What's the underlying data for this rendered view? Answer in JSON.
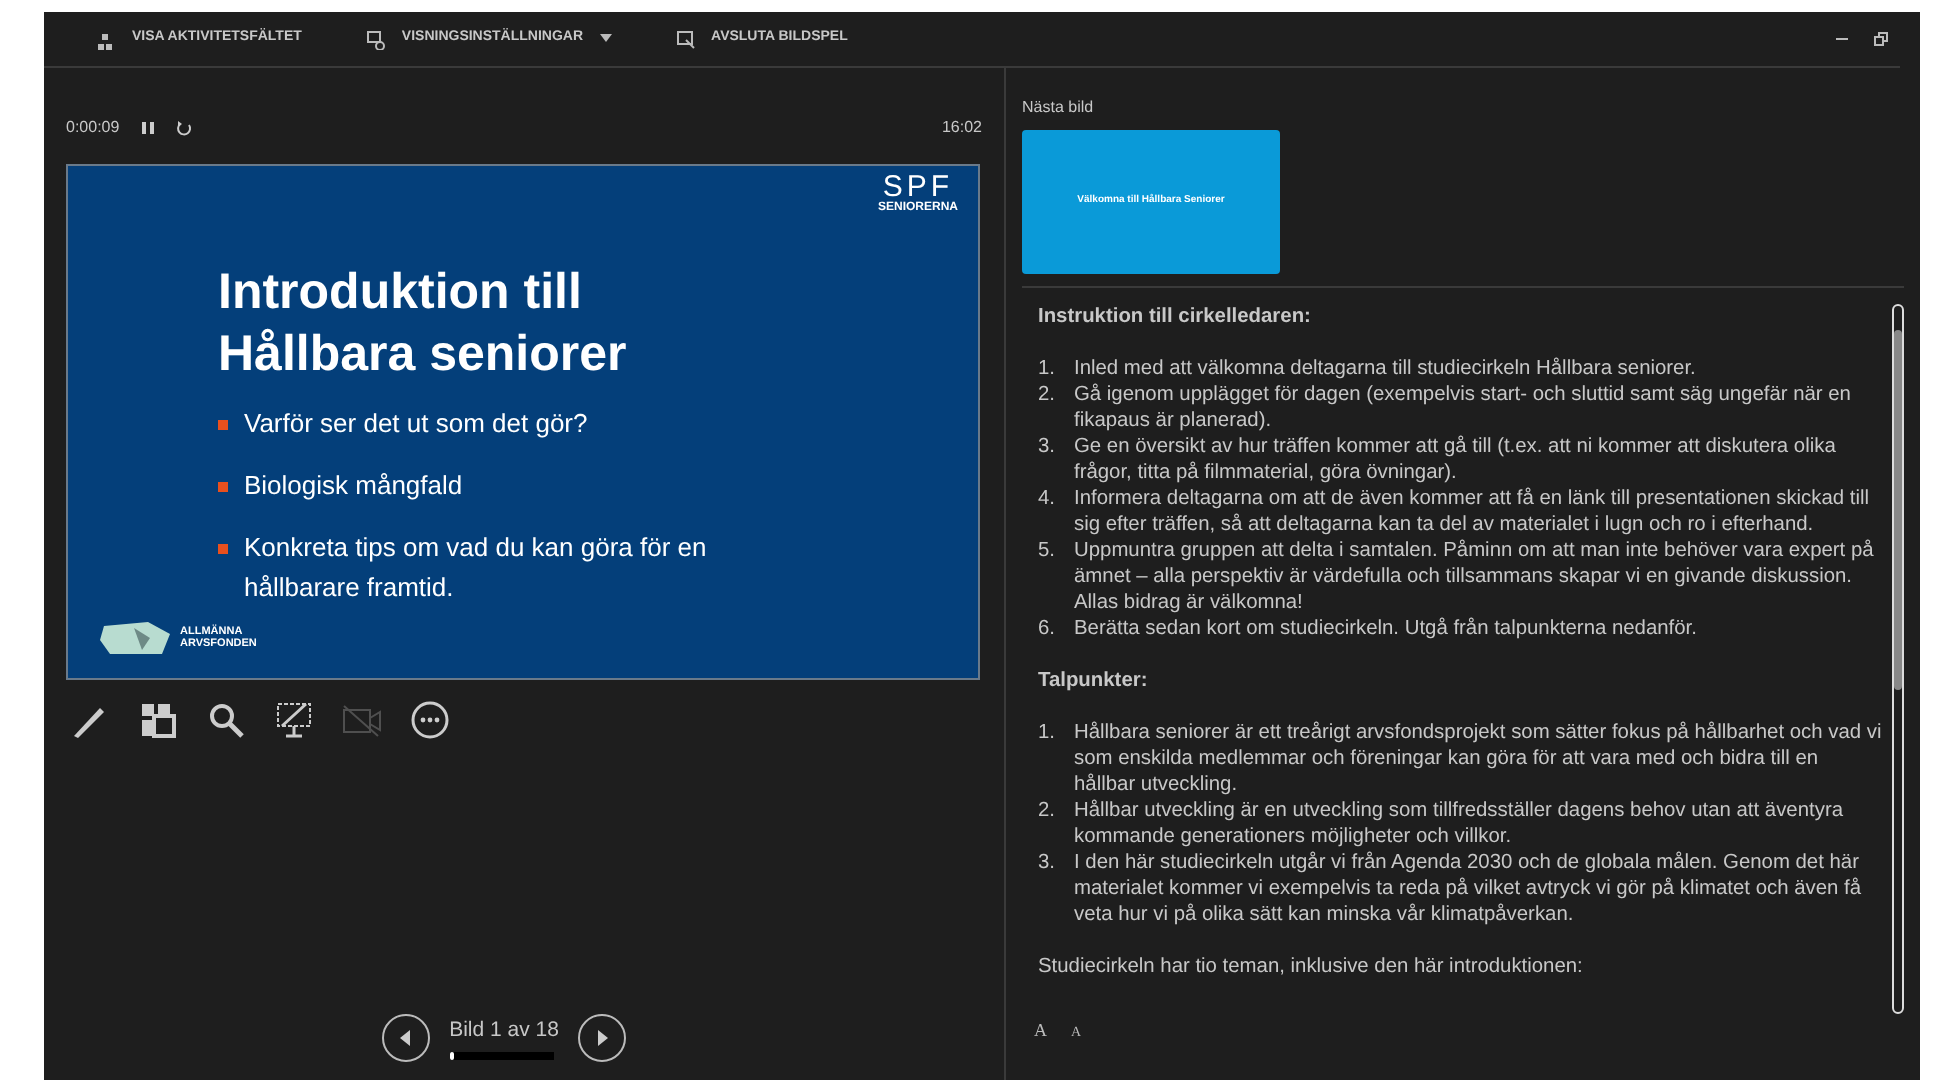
{
  "toolbar": [
    {
      "kind": "taskbar",
      "label": "VISA AKTIVITETSFÄLTET",
      "caret": false
    },
    {
      "kind": "display",
      "label": "VISNINGSINSTÄLLNINGAR",
      "caret": true
    },
    {
      "kind": "end",
      "label": "AVSLUTA BILDSPEL",
      "caret": false
    }
  ],
  "timer": {
    "elapsed": "0:00:09",
    "paused": false,
    "clock": "16:02"
  },
  "slide": {
    "title": "Introduktion till Hållbara seniorer",
    "bullets": [
      "Varför ser det ut som det gör?",
      "Biologisk mångfald",
      "Konkreta tips om vad du kan göra för en hållbarare framtid."
    ],
    "logo_top": {
      "letters": "SPF",
      "word": "SENIORERNA"
    },
    "logo_bottom": "ALLMÄNNA ARVSFONDEN"
  },
  "slide_tools": [
    {
      "kind": "pen",
      "disabled": false
    },
    {
      "kind": "slides",
      "disabled": false
    },
    {
      "kind": "zoom",
      "disabled": false
    },
    {
      "kind": "screen",
      "disabled": false
    },
    {
      "kind": "camera",
      "disabled": true
    },
    {
      "kind": "more",
      "disabled": false
    }
  ],
  "navigation": {
    "label": "Bild 1 av 18",
    "level": 0.05
  },
  "next_slide": {
    "heading": "Nästa bild",
    "thumbnail_text": "Välkomna till Hållbara Seniorer"
  },
  "notes": {
    "sections": [
      {
        "heading": "Instruktion till cirkelledaren:",
        "items": [
          {
            "number": "1.",
            "text": "Inled med att välkomna deltagarna till studiecirkeln Hållbara seniorer."
          },
          {
            "number": "2.",
            "text": "Gå igenom upplägget för dagen (exempelvis start- och sluttid samt säg ungefär när en fikapaus är planerad)."
          },
          {
            "number": "3.",
            "text": "Ge en översikt av hur träffen kommer att gå till (t.ex. att ni kommer att diskutera olika frågor, titta på filmmaterial, göra övningar)."
          },
          {
            "number": "4.",
            "text": "Informera deltagarna om att de även kommer att få en länk till presentationen skickad till sig efter träffen, så att deltagarna kan ta del av materialet i lugn och ro i efterhand."
          },
          {
            "number": "5.",
            "text": "Uppmuntra gruppen att delta i samtalen. Påminn om att man inte behöver vara expert på ämnet – alla perspektiv är värdefulla och tillsammans skapar vi en givande diskussion. Allas bidrag är välkomna!"
          },
          {
            "number": "6.",
            "text": "Berätta sedan kort om studiecirkeln. Utgå från talpunkterna nedanför."
          }
        ]
      },
      {
        "heading": "Talpunkter:",
        "items": [
          {
            "number": "1.",
            "text": "Hållbara seniorer är ett treårigt arvsfondsprojekt som sätter fokus på hållbarhet och vad vi som enskilda medlemmar och föreningar kan göra för att vara med och bidra till en hållbar utveckling."
          },
          {
            "number": "2.",
            "text": "Hållbar utveckling är en utveckling som tillfredsställer dagens behov utan att äventyra kommande generationers möjligheter och villkor."
          },
          {
            "number": "3.",
            "text": "I den här studiecirkeln utgår vi från Agenda 2030 och de globala målen. Genom det här materialet kommer vi exempelvis ta reda på vilket avtryck vi gör på klimatet och även få veta hur vi på olika sätt kan minska vår klimatpåverkan."
          }
        ]
      }
    ],
    "trailing": "Studiecirkeln har tio teman, inklusive den här introduktionen:"
  },
  "font_buttons": [
    {
      "kind": "larger",
      "glyph": "A"
    },
    {
      "kind": "smaller",
      "glyph": "A"
    }
  ]
}
